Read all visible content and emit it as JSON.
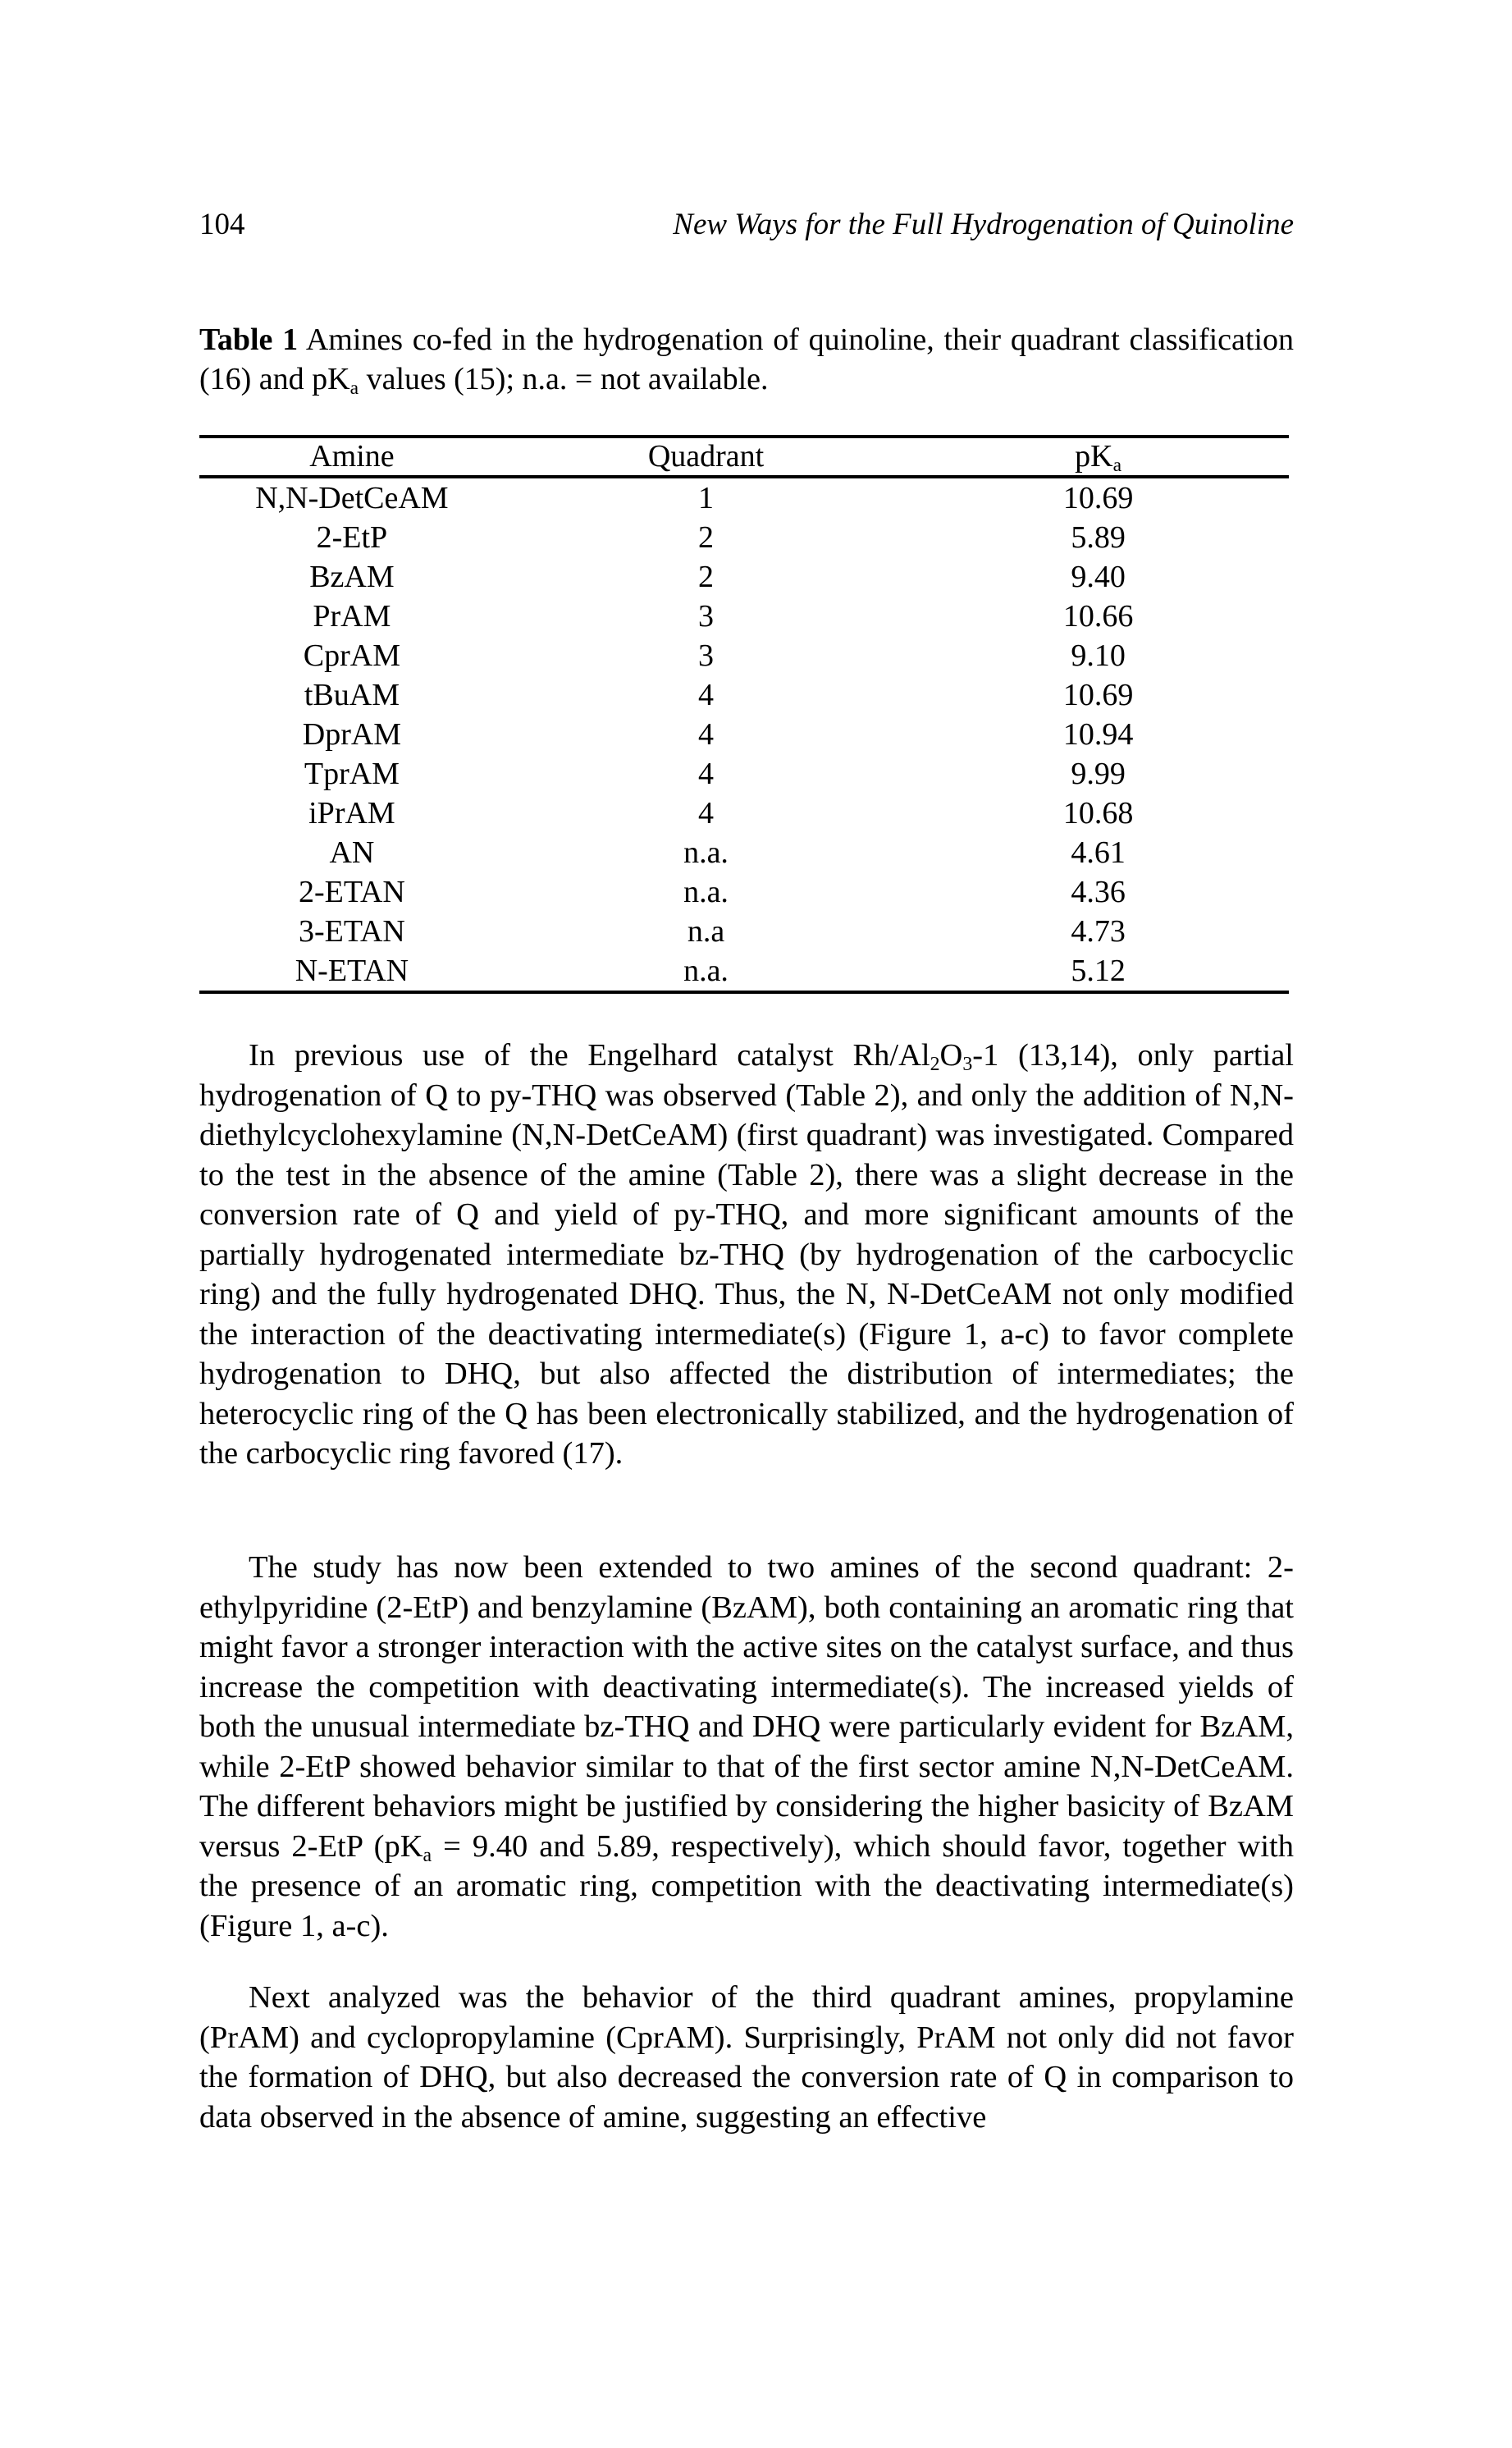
{
  "header": {
    "page_number": "104",
    "running_title": "New Ways for the Full Hydrogenation of Quinoline"
  },
  "table_caption": {
    "label": "Table 1",
    "text_before_sub": " Amines co-fed in the hydrogenation of quinoline, their quadrant classification (16) and pK",
    "sub": "a",
    "text_after_sub": " values (15); n.a. = not available."
  },
  "table": {
    "columns": [
      {
        "label": "Amine"
      },
      {
        "label": "Quadrant"
      },
      {
        "label": "pK",
        "sub": "a"
      }
    ],
    "rows": [
      {
        "amine": "N,N-DetCeAM",
        "quadrant": "1",
        "pka": "10.69"
      },
      {
        "amine": "2-EtP",
        "quadrant": "2",
        "pka": "5.89"
      },
      {
        "amine": "BzAM",
        "quadrant": "2",
        "pka": "9.40"
      },
      {
        "amine": "PrAM",
        "quadrant": "3",
        "pka": "10.66"
      },
      {
        "amine": "CprAM",
        "quadrant": "3",
        "pka": "9.10"
      },
      {
        "amine": "tBuAM",
        "quadrant": "4",
        "pka": "10.69"
      },
      {
        "amine": "DprAM",
        "quadrant": "4",
        "pka": "10.94"
      },
      {
        "amine": "TprAM",
        "quadrant": "4",
        "pka": "9.99"
      },
      {
        "amine": "iPrAM",
        "quadrant": "4",
        "pka": "10.68"
      },
      {
        "amine": "AN",
        "quadrant": "n.a.",
        "pka": "4.61"
      },
      {
        "amine": "2-ETAN",
        "quadrant": "n.a.",
        "pka": "4.36"
      },
      {
        "amine": "3-ETAN",
        "quadrant": "n.a",
        "pka": "4.73"
      },
      {
        "amine": "N-ETAN",
        "quadrant": "n.a.",
        "pka": "5.12"
      }
    ]
  },
  "paragraphs": {
    "p1": {
      "part1": "In previous use of the Engelhard catalyst Rh/Al",
      "sub1": "2",
      "part2": "O",
      "sub2": "3",
      "part3": "-1 (13,14), only partial hydrogenation of Q to py-THQ was observed (Table 2), and only the addition of N,N-diethylcyclohexylamine (N,N-DetCeAM) (first quadrant) was investigated. Compared to the test in the absence of the amine (Table 2), there was a slight decrease in the conversion rate of Q and yield of py-THQ, and more significant amounts of the partially hydrogenated intermediate bz-THQ (by hydrogenation of the carbocyclic ring) and the fully hydrogenated DHQ. Thus, the N, N-DetCeAM not only modified the interaction of the deactivating intermediate(s) (Figure 1, a-c) to favor complete hydrogenation to DHQ, but also affected the distribution of intermediates; the heterocyclic ring of the Q has been electronically stabilized, and the hydrogenation of the carbocyclic ring favored (17)."
    },
    "p2": {
      "part1": "The study has now been extended to two amines of the second quadrant: 2-ethylpyridine (2-EtP) and benzylamine (BzAM), both containing an aromatic ring that might favor a stronger interaction with the active sites on the catalyst surface, and thus increase the competition with deactivating intermediate(s). The increased yields of both the unusual intermediate bz-THQ and DHQ were particularly evident for BzAM, while 2-EtP showed behavior similar to that of the first sector amine N,N-DetCeAM. The different behaviors might be justified by considering the higher basicity of BzAM versus 2-EtP (pK",
      "sub1": "a",
      "part2": " = 9.40 and 5.89, respectively), which should favor, together with the presence of an aromatic ring, competition with the deactivating intermediate(s) (Figure 1, a-c)."
    },
    "p3": {
      "text": "Next analyzed was the behavior of the third quadrant amines, propylamine (PrAM) and cyclopropylamine (CprAM). Surprisingly, PrAM not only did not favor the formation of DHQ, but also decreased the conversion rate of Q in comparison to data observed in the absence of amine, suggesting an effective"
    }
  }
}
